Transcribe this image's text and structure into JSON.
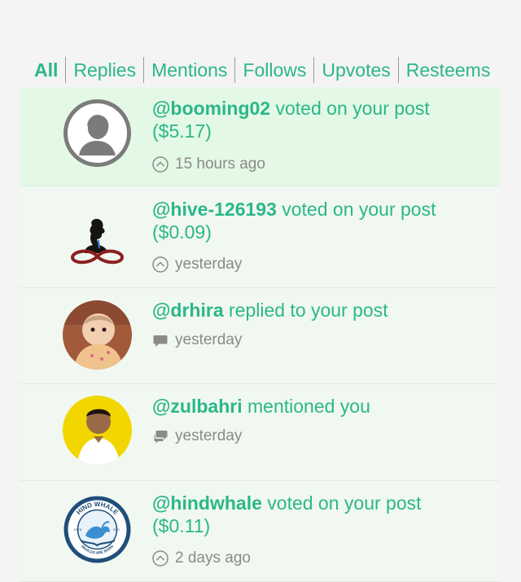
{
  "tabs": [
    {
      "label": "All",
      "active": true
    },
    {
      "label": "Replies"
    },
    {
      "label": "Mentions"
    },
    {
      "label": "Follows"
    },
    {
      "label": "Upvotes"
    },
    {
      "label": "Resteems"
    }
  ],
  "notifications": [
    {
      "user": "@booming02",
      "action": " voted on your post",
      "amount": "($5.17)",
      "time": "15 hours ago",
      "icon": "upvote-icon"
    },
    {
      "user": "@hive-126193",
      "action": " voted on your post",
      "amount": "($0.09)",
      "time": "yesterday",
      "icon": "upvote-icon"
    },
    {
      "user": "@drhira",
      "action": " replied to your post",
      "time": "yesterday",
      "icon": "comment-icon"
    },
    {
      "user": "@zulbahri",
      "action": " mentioned you",
      "time": "yesterday",
      "icon": "mention-icon"
    },
    {
      "user": "@hindwhale",
      "action": " voted on your post",
      "amount": "($0.11)",
      "time": "2 days ago",
      "icon": "upvote-icon",
      "avatar_text": {
        "top": "HIND WHALE",
        "bottom": "WHALES ARE BORN",
        "left": "ESTB",
        "right": "2022"
      }
    }
  ],
  "colors": {
    "accent": "#2bb789",
    "unread_bg": "#e3f9e5",
    "read_bg": "#f1f8f1"
  }
}
